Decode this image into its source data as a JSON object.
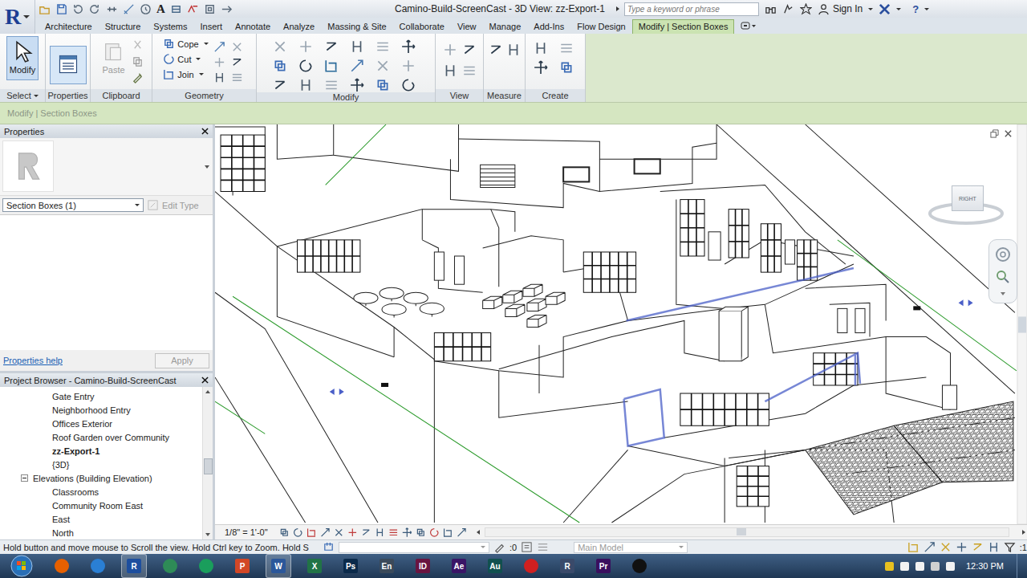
{
  "app": {
    "logo": "R",
    "text_tool": "A",
    "title": "Camino-Build-ScreenCast - 3D View: zz-Export-1",
    "search_placeholder": "Type a keyword or phrase",
    "sign_in": "Sign In",
    "help": "?"
  },
  "tabs": [
    {
      "label": "Architecture",
      "selected": false
    },
    {
      "label": "Structure",
      "selected": false
    },
    {
      "label": "Systems",
      "selected": false
    },
    {
      "label": "Insert",
      "selected": false
    },
    {
      "label": "Annotate",
      "selected": false
    },
    {
      "label": "Analyze",
      "selected": false
    },
    {
      "label": "Massing & Site",
      "selected": false
    },
    {
      "label": "Collaborate",
      "selected": false
    },
    {
      "label": "View",
      "selected": false
    },
    {
      "label": "Manage",
      "selected": false
    },
    {
      "label": "Add-Ins",
      "selected": false
    },
    {
      "label": "Flow Design",
      "selected": false
    },
    {
      "label": "Modify | Section Boxes",
      "selected": true
    }
  ],
  "ribbon": {
    "panels": [
      {
        "label": "Select",
        "menu": true,
        "kind": "large",
        "button": {
          "text": "Modify",
          "selected": true,
          "disabled": false
        }
      },
      {
        "label": "Properties",
        "menu": false,
        "kind": "toggle",
        "on": true
      },
      {
        "label": "Clipboard",
        "menu": false,
        "kind": "clipboard",
        "button": {
          "text": "Paste",
          "selected": false,
          "disabled": true
        }
      },
      {
        "label": "Geometry",
        "menu": false,
        "kind": "tools",
        "tools": [
          {
            "text": "Cope",
            "menu": true,
            "disabled": false
          },
          {
            "text": "Cut",
            "menu": true,
            "disabled": false
          },
          {
            "text": "Join",
            "menu": true,
            "disabled": false
          }
        ]
      },
      {
        "label": "Modify",
        "menu": false,
        "kind": "grid"
      },
      {
        "label": "View",
        "menu": false,
        "kind": "grid"
      },
      {
        "label": "Measure",
        "menu": false,
        "kind": "grid"
      },
      {
        "label": "Create",
        "menu": false,
        "kind": "grid"
      }
    ]
  },
  "options_bar": {
    "text": "Modify | Section Boxes",
    "disabled": true
  },
  "properties": {
    "title": "Properties",
    "type_selector": "Section Boxes (1)",
    "edit_type": {
      "text": "Edit Type",
      "disabled": true
    },
    "help": "Properties help",
    "apply": {
      "text": "Apply",
      "disabled": true
    }
  },
  "project_browser": {
    "title": "Project Browser - Camino-Build-ScreenCast",
    "items": [
      {
        "text": "Gate Entry",
        "kind": "view",
        "selected": false
      },
      {
        "text": "Neighborhood Entry",
        "kind": "view",
        "selected": false
      },
      {
        "text": "Offices Exterior",
        "kind": "view",
        "selected": false
      },
      {
        "text": "Roof Garden over Community",
        "kind": "view",
        "selected": false
      },
      {
        "text": "zz-Export-1",
        "kind": "view",
        "selected": true
      },
      {
        "text": "{3D}",
        "kind": "view",
        "selected": false
      },
      {
        "text": "Elevations (Building Elevation)",
        "kind": "group",
        "expanded": true,
        "selected": false
      },
      {
        "text": "Classrooms",
        "kind": "view",
        "selected": false
      },
      {
        "text": "Community Room East",
        "kind": "view",
        "selected": false
      },
      {
        "text": "East",
        "kind": "view",
        "selected": false
      },
      {
        "text": "North",
        "kind": "view",
        "selected": false
      }
    ]
  },
  "viewport": {
    "scale": "1/8\" = 1'-0\"",
    "view_cube_face": "RIGHT"
  },
  "status_bar": {
    "hint": "Hold button and move mouse to Scroll the view. Hold Ctrl key to Zoom. Hold S",
    "worksets": ":0",
    "model": "Main Model",
    "filter": ":1"
  },
  "taskbar": {
    "apps": [
      {
        "label": "",
        "kind": "round",
        "color": "#e66000",
        "selected": false
      },
      {
        "label": "",
        "kind": "round",
        "color": "#2a7fd4",
        "selected": false
      },
      {
        "label": "R",
        "kind": "badge",
        "color": "#1d4e9e",
        "selected": true
      },
      {
        "label": "",
        "kind": "round",
        "color": "#2e8b57",
        "selected": false
      },
      {
        "label": "",
        "kind": "round",
        "color": "#1a9e5c",
        "selected": false
      },
      {
        "label": "P",
        "kind": "badge",
        "color": "#d24726",
        "selected": false
      },
      {
        "label": "W",
        "kind": "badge",
        "color": "#2b579a",
        "selected": true
      },
      {
        "label": "X",
        "kind": "badge",
        "color": "#217346",
        "selected": false
      },
      {
        "label": "Ps",
        "kind": "badge",
        "color": "#0b2a4a",
        "selected": false
      },
      {
        "label": "En",
        "kind": "badge",
        "color": "#3b4a5a",
        "selected": false
      },
      {
        "label": "ID",
        "kind": "badge",
        "color": "#6a1440",
        "selected": false
      },
      {
        "label": "Ae",
        "kind": "badge",
        "color": "#3a1566",
        "selected": false
      },
      {
        "label": "Au",
        "kind": "badge",
        "color": "#11504f",
        "selected": false
      },
      {
        "label": "",
        "kind": "round",
        "color": "#d02020",
        "selected": false
      },
      {
        "label": "R",
        "kind": "badge",
        "color": "#3a4a6a",
        "selected": false
      },
      {
        "label": "Pr",
        "kind": "badge",
        "color": "#3a0f5e",
        "selected": false
      },
      {
        "label": "",
        "kind": "round",
        "color": "#111111",
        "selected": false
      }
    ],
    "time": "12:30 PM"
  }
}
